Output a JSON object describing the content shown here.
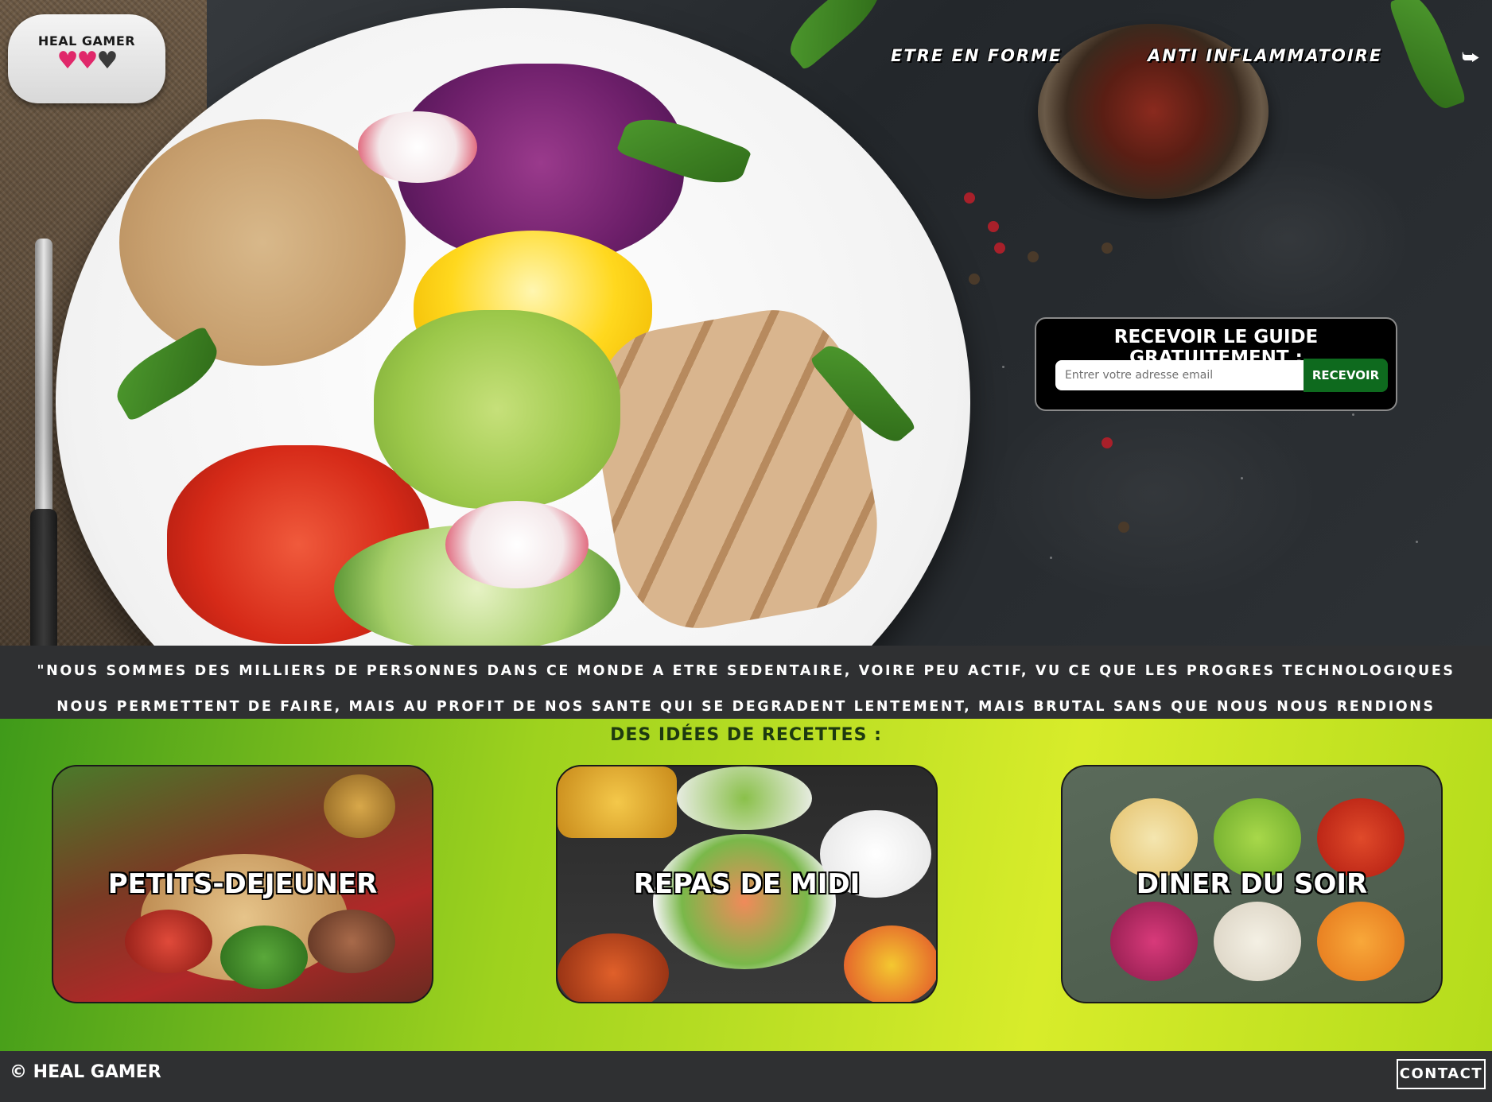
{
  "logo": {
    "text": "HEAL GAMER",
    "hearts": [
      "♥",
      "♥",
      "♥"
    ]
  },
  "nav": {
    "links": [
      {
        "label": "ETRE EN FORME"
      },
      {
        "label": "ANTI INFLAMMATOIRE"
      }
    ],
    "signin_icon": "sign-in-icon"
  },
  "newsletter": {
    "title": "RECEVOIR LE GUIDE GRATUITEMENT :",
    "email_placeholder": "Entrer votre adresse email",
    "email_value": "",
    "submit_label": "RECEVOIR"
  },
  "quote": {
    "text": "\"NOUS SOMMES DES MILLIERS DE PERSONNES DANS CE MONDE A ETRE SEDENTAIRE, VOIRE PEU ACTIF, VU CE QUE LES PROGRES TECHNOLOGIQUES NOUS PERMETTENT DE FAIRE, MAIS AU PROFIT DE NOS SANTE QUI SE DEGRADENT LENTEMENT, MAIS BRUTAL SANS QUE NOUS NOUS RENDIONS COMPTE.\""
  },
  "recipes": {
    "title": "DES IDÉES DE RECETTES :",
    "cards": [
      {
        "label": "PETITS-DEJEUNER"
      },
      {
        "label": "REPAS DE MIDI"
      },
      {
        "label": "DINER DU SOIR"
      }
    ]
  },
  "footer": {
    "copyright": "© HEAL GAMER",
    "contact_label": "CONTACT"
  },
  "colors": {
    "accent_green": "#0e6a1e",
    "band_gray": "#2f3032",
    "heart_pink": "#e0286a",
    "lime": "#b4dc1c"
  }
}
